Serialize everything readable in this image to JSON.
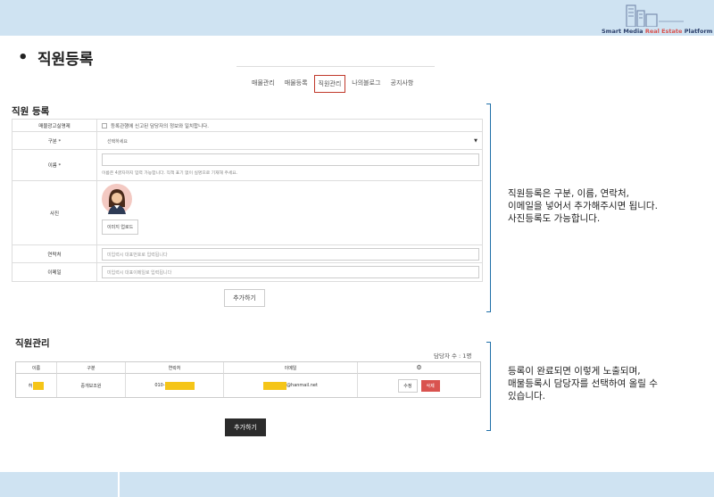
{
  "branding": {
    "logo_text_1": "Smart Media ",
    "logo_text_highlight": "Real Estate",
    "logo_text_2": " Platform"
  },
  "page": {
    "bullet": "•",
    "heading": "직원등록"
  },
  "nav": {
    "items": [
      "매물관리",
      "매물등록",
      "직원관리",
      "나의블로그",
      "공지사항"
    ],
    "active_index": 2
  },
  "register": {
    "title": "직원 등록",
    "consent_label": "매물광고실명제",
    "consent_text": "등록관행에 신고된 담당자의 정보와 일치합니다.",
    "type_label": "구분 *",
    "type_placeholder": "선택하세요",
    "name_label": "이름 *",
    "name_hint": "이름은 4글자까지 입력 가능합니다. 직책 표기 없이 실명으로 기재해 주세요.",
    "photo_label": "사진",
    "upload_label": "이미지 업로드",
    "phone_label": "연락처",
    "phone_placeholder": "미입력시 대표번호로 입력됩니다",
    "email_label": "이메일",
    "email_placeholder": "미입력시 대표이메일로 입력됩니다",
    "submit_label": "추가하기"
  },
  "note1": [
    "직원등록은 구분, 이름, 연락처,",
    "이메일을 넣어서 추가해주시면 됩니다.",
    "사진등록도 가능합니다."
  ],
  "manage": {
    "title": "직원관리",
    "count_text": "담당자 수 : 1명",
    "headers": [
      "이름",
      "구분",
      "연락처",
      "이메일",
      ""
    ],
    "row": {
      "name": "허",
      "type": "중개보조원",
      "phone": "010-",
      "email": "@hanmail.net",
      "edit_label": "수정",
      "delete_label": "삭제"
    },
    "add_label": "추가하기"
  },
  "note2": [
    "등록이 완료되면 이렇게 노출되며,",
    "매물등록시 담당자를 선택하여 올릴 수",
    "있습니다."
  ],
  "colors": {
    "accent_blue": "#1f6fa8",
    "delete_red": "#d9534f",
    "mask_yellow": "#f5c518",
    "bar_blue": "#cfe3f2"
  }
}
